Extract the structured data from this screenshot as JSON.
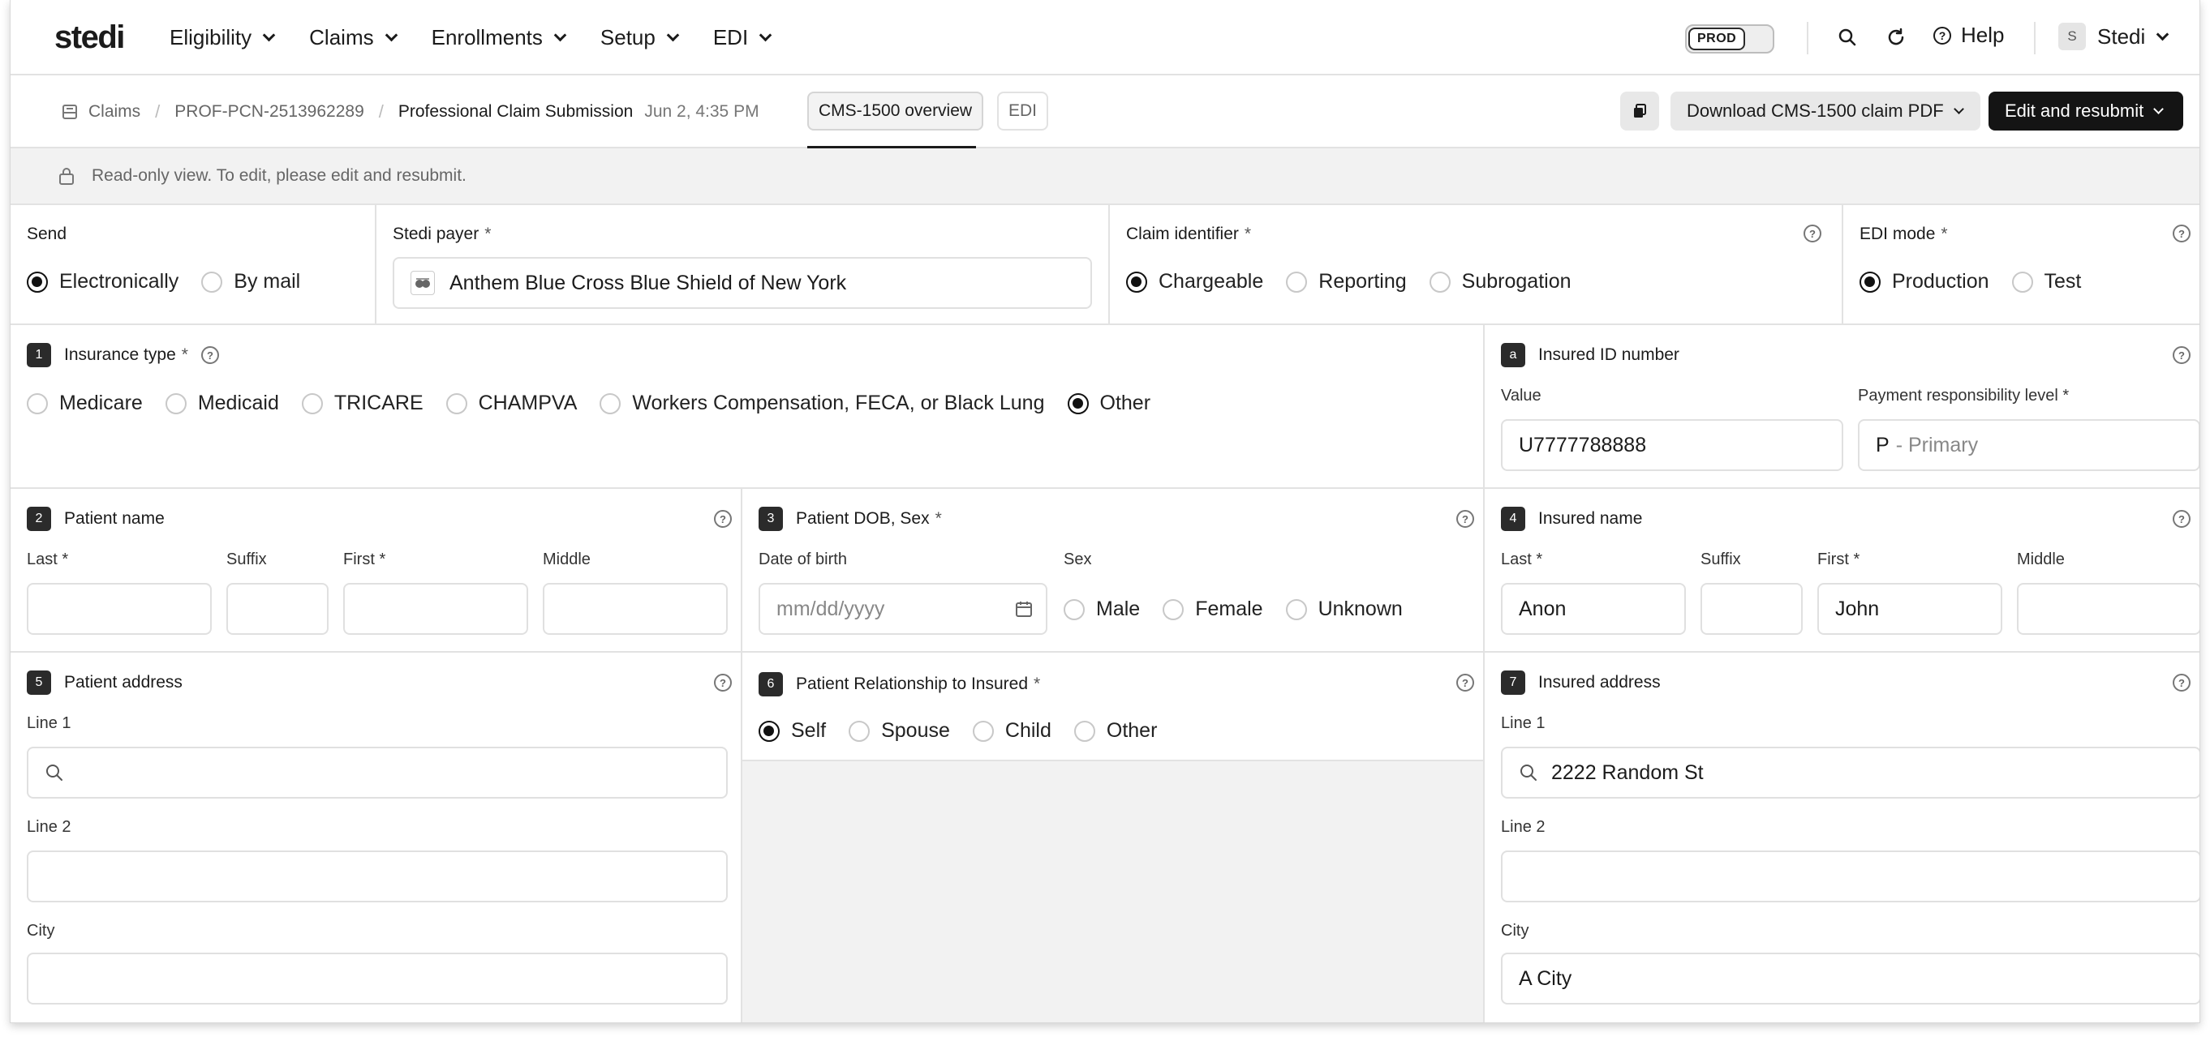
{
  "nav": {
    "logo": "stedi",
    "items": [
      "Eligibility",
      "Claims",
      "Enrollments",
      "Setup",
      "EDI"
    ],
    "env_badge": "PROD",
    "help": "Help",
    "user_initial": "S",
    "user_name": "Stedi"
  },
  "breadcrumb": {
    "root": "Claims",
    "id": "PROF-PCN-2513962289",
    "current": "Professional Claim Submission",
    "date": "Jun 2, 4:35 PM",
    "tabs": [
      "CMS-1500 overview",
      "EDI"
    ],
    "download_label": "Download CMS-1500 claim PDF",
    "resubmit_label": "Edit and resubmit"
  },
  "readonly_notice": "Read-only view. To edit, please edit and resubmit.",
  "send": {
    "label": "Send",
    "options": [
      "Electronically",
      "By mail"
    ],
    "selected": "Electronically"
  },
  "payer": {
    "label": "Stedi payer",
    "required": "*",
    "value": "Anthem Blue Cross Blue Shield of New York"
  },
  "claim_identifier": {
    "label": "Claim identifier",
    "required": "*",
    "options": [
      "Chargeable",
      "Reporting",
      "Subrogation"
    ],
    "selected": "Chargeable"
  },
  "edi_mode": {
    "label": "EDI mode",
    "required": "*",
    "options": [
      "Production",
      "Test"
    ],
    "selected": "Production"
  },
  "insurance_type": {
    "number": "1",
    "label": "Insurance type",
    "required": "*",
    "options": [
      "Medicare",
      "Medicaid",
      "TRICARE",
      "CHAMPVA",
      "Workers Compensation, FECA, or Black Lung",
      "Other"
    ],
    "selected": "Other"
  },
  "insured_id": {
    "number": "a",
    "label": "Insured ID number",
    "value_label": "Value",
    "value": "U7777788888",
    "payment_label": "Payment responsibility level",
    "required": "*",
    "payment_code": "P",
    "payment_desc": "- Primary"
  },
  "patient_name": {
    "number": "2",
    "label": "Patient name",
    "last_label": "Last",
    "suffix_label": "Suffix",
    "first_label": "First",
    "middle_label": "Middle",
    "required": "*"
  },
  "patient_dob": {
    "number": "3",
    "label": "Patient DOB, Sex",
    "required": "*",
    "dob_label": "Date of birth",
    "dob_placeholder": "mm/dd/yyyy",
    "sex_label": "Sex",
    "sex_options": [
      "Male",
      "Female",
      "Unknown"
    ]
  },
  "insured_name": {
    "number": "4",
    "label": "Insured name",
    "last_label": "Last",
    "suffix_label": "Suffix",
    "first_label": "First",
    "middle_label": "Middle",
    "required": "*",
    "last": "Anon",
    "first": "John"
  },
  "patient_address": {
    "number": "5",
    "label": "Patient address",
    "line1_label": "Line 1",
    "line2_label": "Line 2",
    "city_label": "City"
  },
  "relationship": {
    "number": "6",
    "label": "Patient Relationship to Insured",
    "required": "*",
    "options": [
      "Self",
      "Spouse",
      "Child",
      "Other"
    ],
    "selected": "Self"
  },
  "insured_address": {
    "number": "7",
    "label": "Insured address",
    "line1_label": "Line 1",
    "line1": "2222 Random St",
    "line2_label": "Line 2",
    "city_label": "City",
    "city": "A City"
  }
}
